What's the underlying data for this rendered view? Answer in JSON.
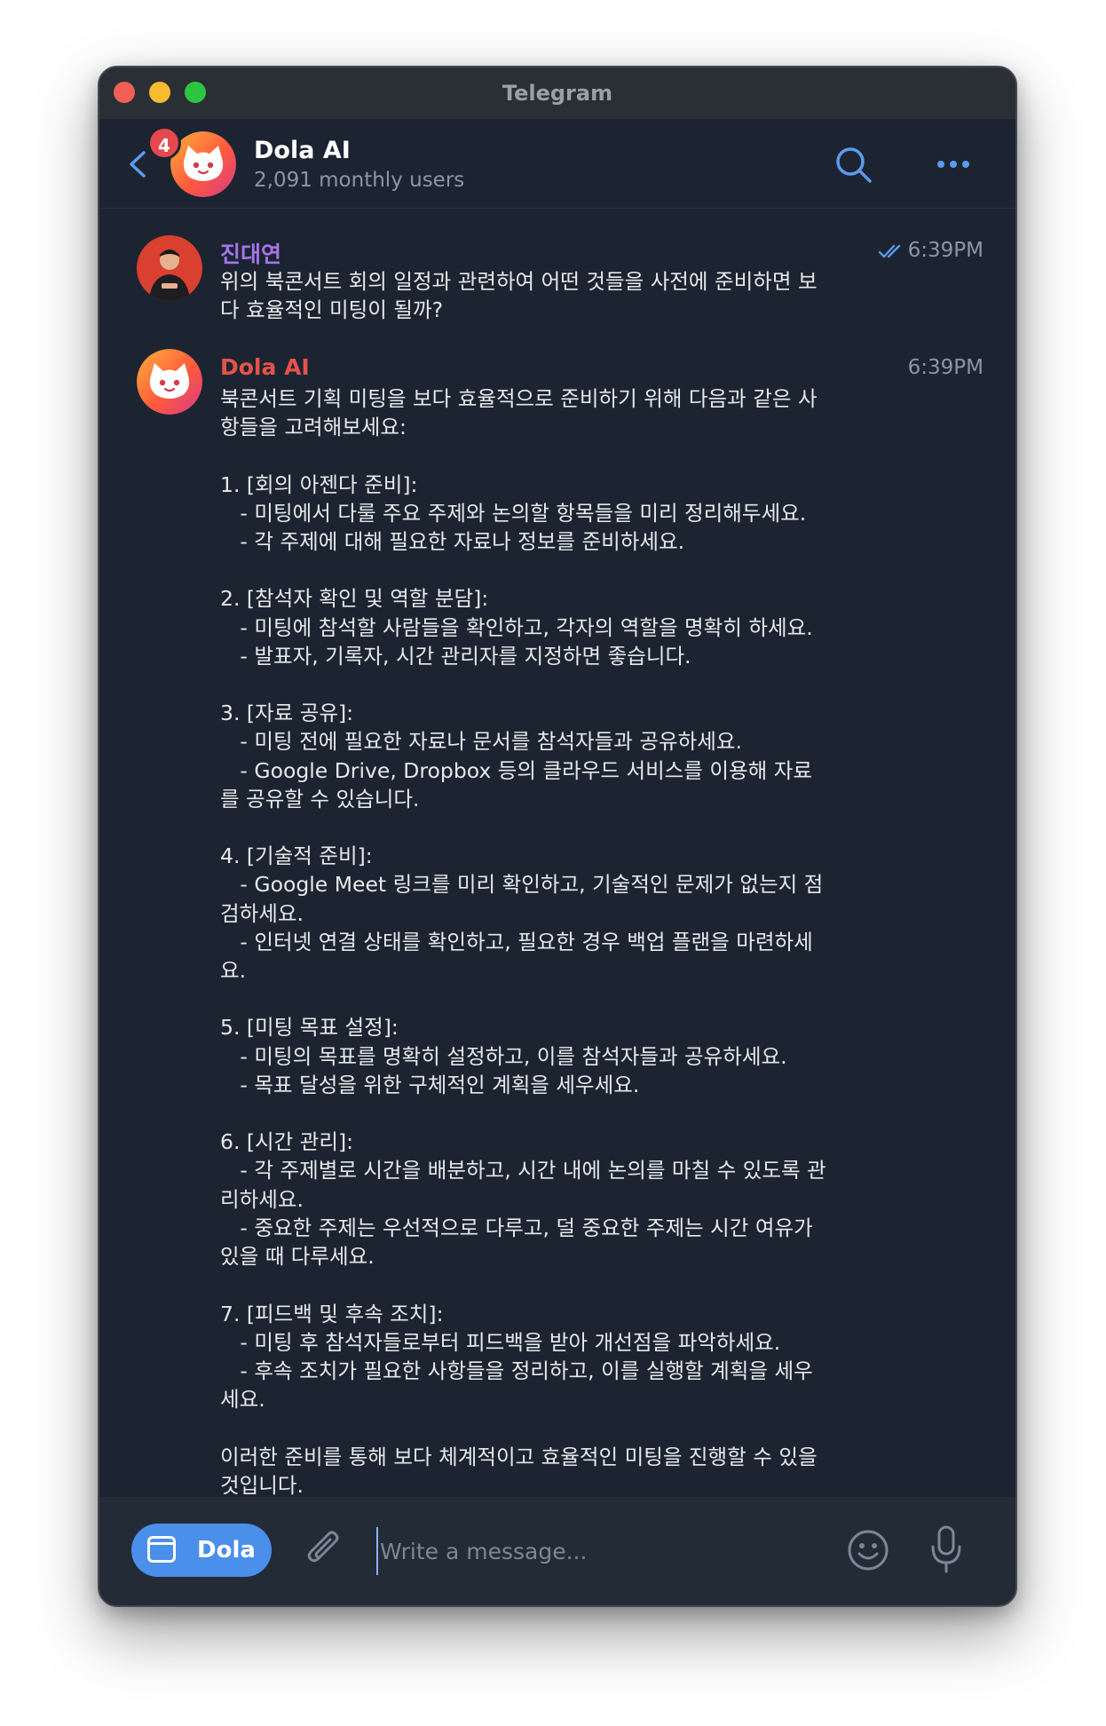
{
  "window": {
    "title": "Telegram"
  },
  "header": {
    "chat_name": "Dola AI",
    "subtitle": "2,091 monthly users",
    "unread_badge": "4",
    "icons": [
      "back-arrow-icon",
      "search-icon",
      "more-icon"
    ]
  },
  "messages": [
    {
      "sender": "진대연",
      "sender_color": "#a574e8",
      "time": "6:39PM",
      "read_status": "double-check-icon",
      "text": "위의 북콘서트 회의 일정과 관련하여 어떤 것들을 사전에 준비하면 보\n다 효율적인 미팅이 될까?"
    },
    {
      "sender": "Dola AI",
      "sender_color": "#e5534b",
      "time": "6:39PM",
      "text": "북콘서트 기획 미팅을 보다 효율적으로 준비하기 위해 다음과 같은 사\n항들을 고려해보세요:\n\n1. [회의 아젠다 준비]:\n   - 미팅에서 다룰 주요 주제와 논의할 항목들을 미리 정리해두세요.\n   - 각 주제에 대해 필요한 자료나 정보를 준비하세요.\n\n2. [참석자 확인 및 역할 분담]:\n   - 미팅에 참석할 사람들을 확인하고, 각자의 역할을 명확히 하세요.\n   - 발표자, 기록자, 시간 관리자를 지정하면 좋습니다.\n\n3. [자료 공유]:\n   - 미팅 전에 필요한 자료나 문서를 참석자들과 공유하세요.\n   - Google Drive, Dropbox 등의 클라우드 서비스를 이용해 자료\n를 공유할 수 있습니다.\n\n4. [기술적 준비]:\n   - Google Meet 링크를 미리 확인하고, 기술적인 문제가 없는지 점\n검하세요.\n   - 인터넷 연결 상태를 확인하고, 필요한 경우 백업 플랜을 마련하세\n요.\n\n5. [미팅 목표 설정]:\n   - 미팅의 목표를 명확히 설정하고, 이를 참석자들과 공유하세요.\n   - 목표 달성을 위한 구체적인 계획을 세우세요.\n\n6. [시간 관리]:\n   - 각 주제별로 시간을 배분하고, 시간 내에 논의를 마칠 수 있도록 관\n리하세요.\n   - 중요한 주제는 우선적으로 다루고, 덜 중요한 주제는 시간 여유가\n있을 때 다루세요.\n\n7. [피드백 및 후속 조치]:\n   - 미팅 후 참석자들로부터 피드백을 받아 개선점을 파악하세요.\n   - 후속 조치가 필요한 사항들을 정리하고, 이를 실행할 계획을 세우\n세요.\n\n이러한 준비를 통해 보다 체계적이고 효율적인 미팅을 진행할 수 있을\n것입니다."
    }
  ],
  "composer": {
    "bot_button_label": "Dola",
    "placeholder": "Write a message...",
    "icons": [
      "attach-icon",
      "emoji-icon",
      "microphone-icon"
    ]
  },
  "colors": {
    "window_bg": "#1c2431",
    "composer_bg": "#232b37",
    "accent": "#4a8fea",
    "badge": "#e5484d",
    "icon_blue": "#5b9bf0"
  }
}
